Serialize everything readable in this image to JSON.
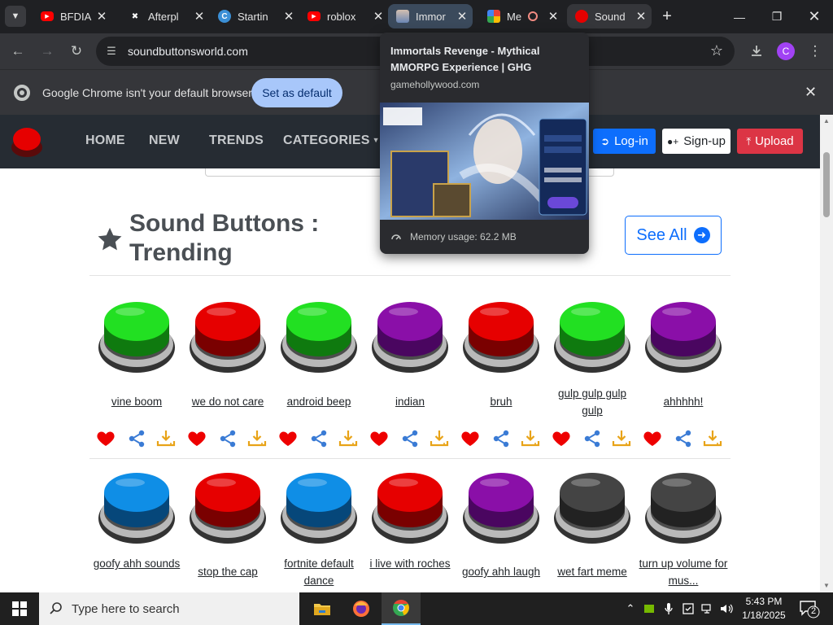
{
  "browser": {
    "tabs": [
      {
        "title": "BFDIA",
        "favicon": "youtube-icon",
        "color": "#ff0000"
      },
      {
        "title": "Afterpl",
        "favicon": "afterplay-icon",
        "color": "#ffffff"
      },
      {
        "title": "Startin",
        "favicon": "cloud-c-icon",
        "color": "#3b8fd6"
      },
      {
        "title": "roblox",
        "favicon": "youtube-icon",
        "color": "#ff0000"
      },
      {
        "title": "Immor",
        "favicon": "game-avatar-icon",
        "color": "#9ab4d4"
      },
      {
        "title": "Me",
        "favicon": "meet-icon",
        "color": "#00ac47"
      },
      {
        "title": "Sound",
        "favicon": "red-button-icon",
        "color": "#e60000"
      }
    ],
    "url": "soundbuttonsworld.com",
    "profile_initial": "C"
  },
  "infobar": {
    "message": "Google Chrome isn't your default browser",
    "button": "Set as default"
  },
  "hovercard": {
    "title": "Immortals Revenge - Mythical MMORPG Experience | GHG",
    "domain": "gamehollywood.com",
    "memory": "Memory usage: 62.2 MB"
  },
  "site": {
    "nav": [
      "HOME",
      "NEW",
      "TRENDS",
      "CATEGORIES"
    ],
    "login": "Log-in",
    "signup": "Sign-up",
    "upload": "Upload",
    "section_title": "Sound Buttons : Trending",
    "see_all": "See All",
    "buttons": [
      {
        "label": "vine boom",
        "color": "green"
      },
      {
        "label": "we do not care",
        "color": "red"
      },
      {
        "label": "android beep",
        "color": "green"
      },
      {
        "label": "indian",
        "color": "purple"
      },
      {
        "label": "bruh",
        "color": "red"
      },
      {
        "label": "gulp gulp gulp gulp",
        "color": "green"
      },
      {
        "label": "ahhhhh!",
        "color": "purple"
      },
      {
        "label": "goofy ahh sounds",
        "color": "blue"
      },
      {
        "label": "stop the cap",
        "color": "red"
      },
      {
        "label": "fortnite default dance",
        "color": "blue"
      },
      {
        "label": "i live with roches",
        "color": "red"
      },
      {
        "label": "goofy ahh laugh",
        "color": "purple"
      },
      {
        "label": "wet fart meme",
        "color": "gray"
      },
      {
        "label": "turn up volume for mus...",
        "color": "gray"
      }
    ]
  },
  "palette": {
    "green": {
      "top": "#22e022",
      "side": "#0f7a0f"
    },
    "red": {
      "top": "#e60000",
      "side": "#7a0000"
    },
    "purple": {
      "top": "#8a0fa8",
      "side": "#4a0660"
    },
    "blue": {
      "top": "#0f8ee6",
      "side": "#06477a"
    },
    "gray": {
      "top": "#444444",
      "side": "#222222"
    }
  },
  "taskbar": {
    "search_placeholder": "Type here to search",
    "time": "5:43 PM",
    "date": "1/18/2025",
    "notification_count": "2"
  }
}
